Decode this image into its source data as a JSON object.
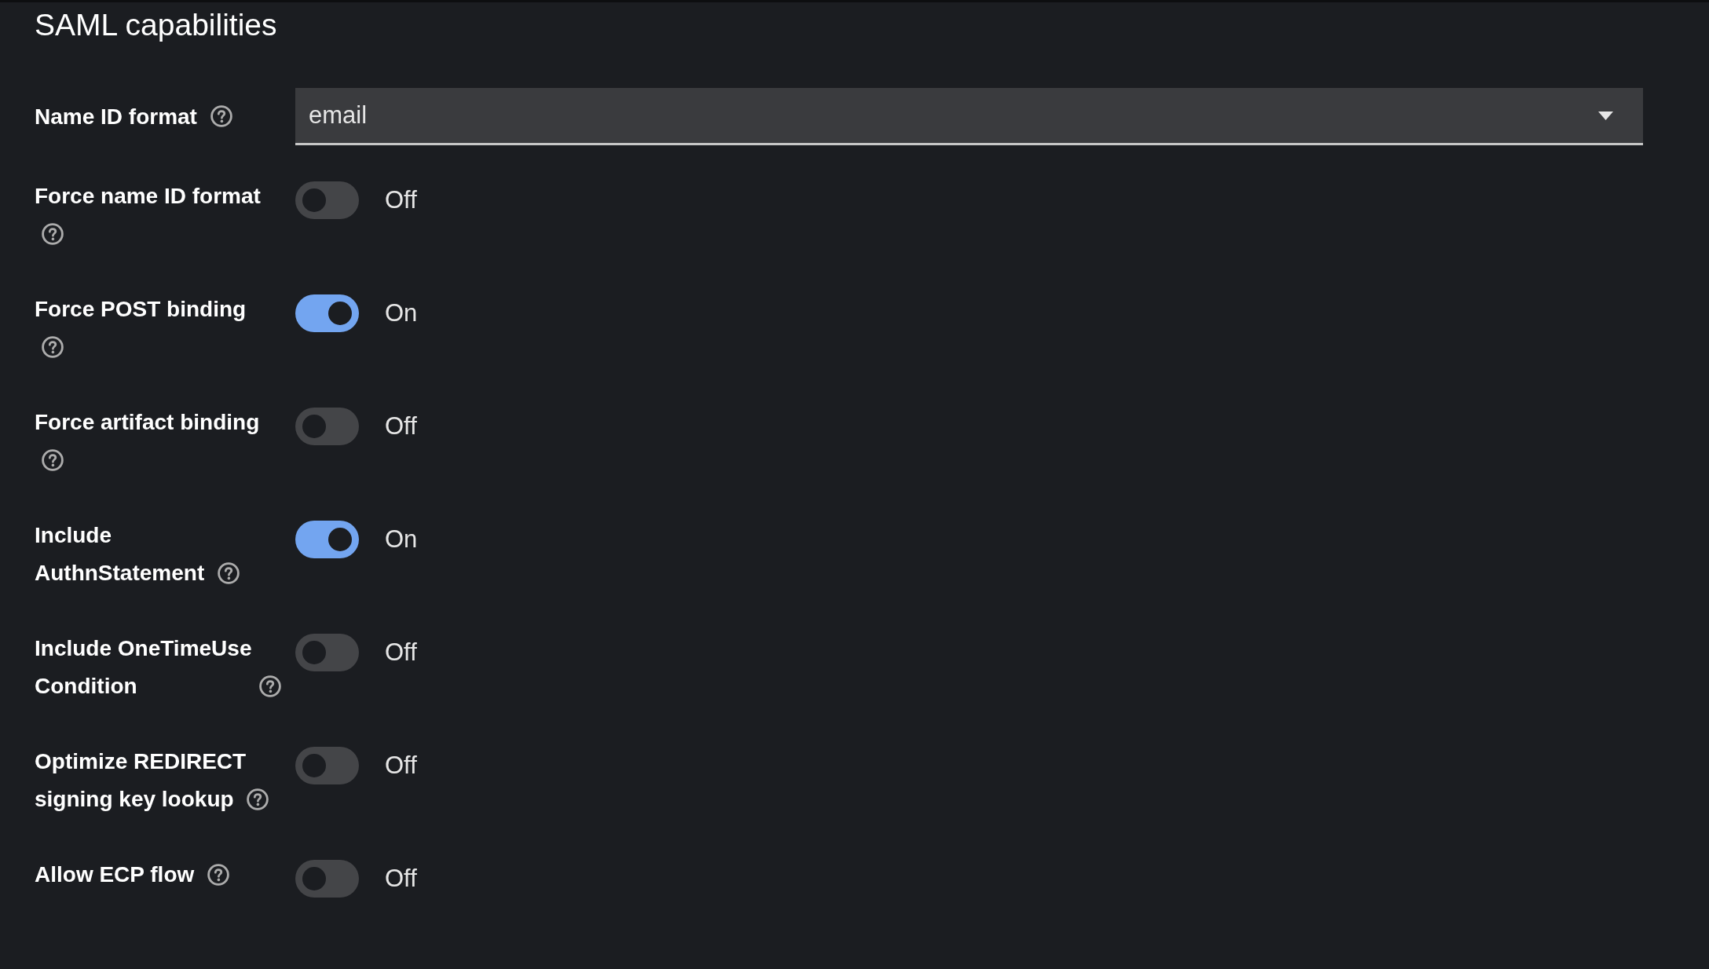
{
  "section_title": "SAML capabilities",
  "fields": [
    {
      "kind": "select",
      "label": "Name ID format",
      "value": "email"
    },
    {
      "kind": "switch",
      "label": "Force name ID format",
      "on": false,
      "state_label": "Off"
    },
    {
      "kind": "switch",
      "label": "Force POST binding",
      "on": true,
      "state_label": "On"
    },
    {
      "kind": "switch",
      "label": "Force artifact binding",
      "on": false,
      "state_label": "Off"
    },
    {
      "kind": "switch",
      "label": "Include AuthnStatement",
      "on": true,
      "state_label": "On"
    },
    {
      "kind": "switch",
      "label": "Include OneTimeUse Condition",
      "on": false,
      "state_label": "Off"
    },
    {
      "kind": "switch",
      "label": "Optimize REDIRECT signing key lookup",
      "on": false,
      "state_label": "Off"
    },
    {
      "kind": "switch",
      "label": "Allow ECP flow",
      "on": false,
      "state_label": "Off"
    }
  ]
}
